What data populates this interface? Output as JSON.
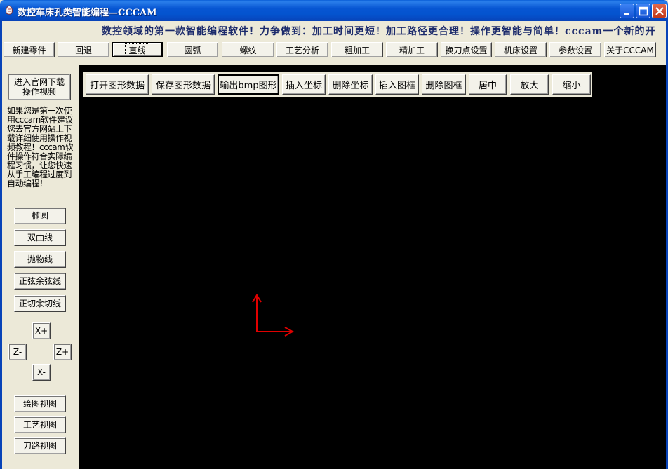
{
  "window": {
    "title": "数控车床孔类智能编程—CCCAM"
  },
  "marquee": {
    "text": "数控领域的第一款智能编程软件！力争做到：加工时间更短！加工路径更合理！操作更智能与简单！cccam一个新的开"
  },
  "toolbar": {
    "items": [
      "新建零件",
      "回退",
      "直线",
      "圆弧",
      "螺纹",
      "工艺分析",
      "粗加工",
      "精加工",
      "换刀点设置",
      "机床设置",
      "参数设置",
      "关于CCCAM"
    ],
    "active": "直线"
  },
  "left": {
    "download_button": "进入官网下载操作视频",
    "intro_text": "如果您是第一次使用cccam软件建议您去官方网站上下载详细使用操作视频教程！cccam软件操作符合实际编程习惯，让您快速从手工编程过度到自动编程！",
    "curves": [
      "椭圆",
      "双曲线",
      "抛物线",
      "正弦余弦线",
      "正切余切线"
    ],
    "jog": {
      "xplus": "X+",
      "zminus": "Z-",
      "zplus": "Z+",
      "xminus": "X-"
    },
    "views": [
      "绘图视图",
      "工艺视图",
      "刀路视图"
    ]
  },
  "canvas_toolbar": {
    "items": [
      "打开图形数据",
      "保存图形数据",
      "输出bmp图形",
      "插入坐标",
      "删除坐标",
      "插入图框",
      "删除图框",
      "居中",
      "放大",
      "缩小"
    ],
    "active": "输出bmp图形"
  },
  "canvas": {
    "background": "#000000",
    "axis_color": "#E00000"
  }
}
